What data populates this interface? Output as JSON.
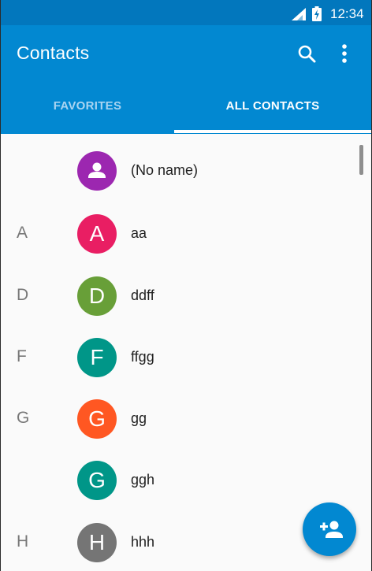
{
  "status_bar": {
    "time": "12:34",
    "signal_icon": "signal-icon",
    "battery_icon": "battery-charging-icon"
  },
  "app_bar": {
    "title": "Contacts",
    "search_icon": "search-icon",
    "more_icon": "more-vert-icon",
    "background_color": "#0288d1",
    "status_color": "#0277bd"
  },
  "tabs": [
    {
      "label": "FAVORITES",
      "selected": false
    },
    {
      "label": "ALL CONTACTS",
      "selected": true
    }
  ],
  "contacts": [
    {
      "section": "",
      "initial": "",
      "name": "(No name)",
      "color": "#9c27b0",
      "icon": "person-icon"
    },
    {
      "section": "A",
      "initial": "A",
      "name": "aa",
      "color": "#e91e63"
    },
    {
      "section": "D",
      "initial": "D",
      "name": "ddff",
      "color": "#689f38"
    },
    {
      "section": "F",
      "initial": "F",
      "name": "ffgg",
      "color": "#009688"
    },
    {
      "section": "G",
      "initial": "G",
      "name": "gg",
      "color": "#ff5722"
    },
    {
      "section": "",
      "initial": "G",
      "name": "ggh",
      "color": "#009688"
    },
    {
      "section": "H",
      "initial": "H",
      "name": "hhh",
      "color": "#757575"
    }
  ],
  "fab": {
    "icon": "add-contact-icon"
  }
}
